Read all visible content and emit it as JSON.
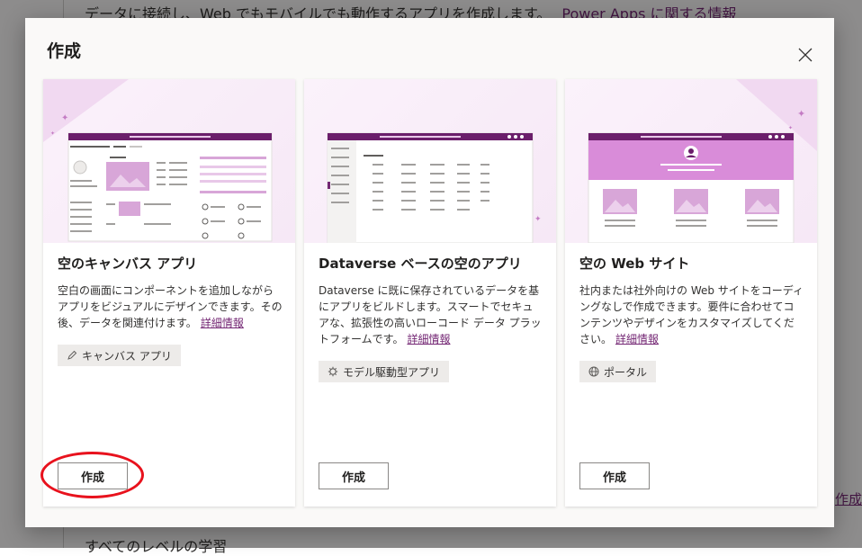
{
  "background": {
    "top_text": "データに接続し、Web でもモバイルでも動作するアプリを作成します。",
    "top_link": "Power Apps に関する情報",
    "bottom_text": "すべてのレベルの学習",
    "right_link": "作成"
  },
  "dialog": {
    "title": "作成",
    "close_icon": "close-icon"
  },
  "cards": [
    {
      "title": "空のキャンバス アプリ",
      "description": "空白の画面にコンポーネントを追加しながらアプリをビジュアルにデザインできます。その後、データを関連付けます。",
      "link": "詳細情報",
      "tag": "キャンバス アプリ",
      "tag_icon": "pencil-icon",
      "button": "作成"
    },
    {
      "title": "Dataverse ベースの空のアプリ",
      "description": "Dataverse に既に保存されているデータを基にアプリをビルドします。スマートでセキュアな、拡張性の高いローコード データ プラットフォームです。",
      "link": "詳細情報",
      "tag": "モデル駆動型アプリ",
      "tag_icon": "gear-icon",
      "button": "作成"
    },
    {
      "title": "空の Web サイト",
      "description": "社内または社外向けの Web サイトをコーディングなしで作成できます。要件に合わせてコンテンツやデザインをカスタマイズしてください。",
      "link": "詳細情報",
      "tag": "ポータル",
      "tag_icon": "globe-icon",
      "button": "作成"
    }
  ],
  "colors": {
    "accent": "#742774",
    "highlight": "#e8121d"
  }
}
